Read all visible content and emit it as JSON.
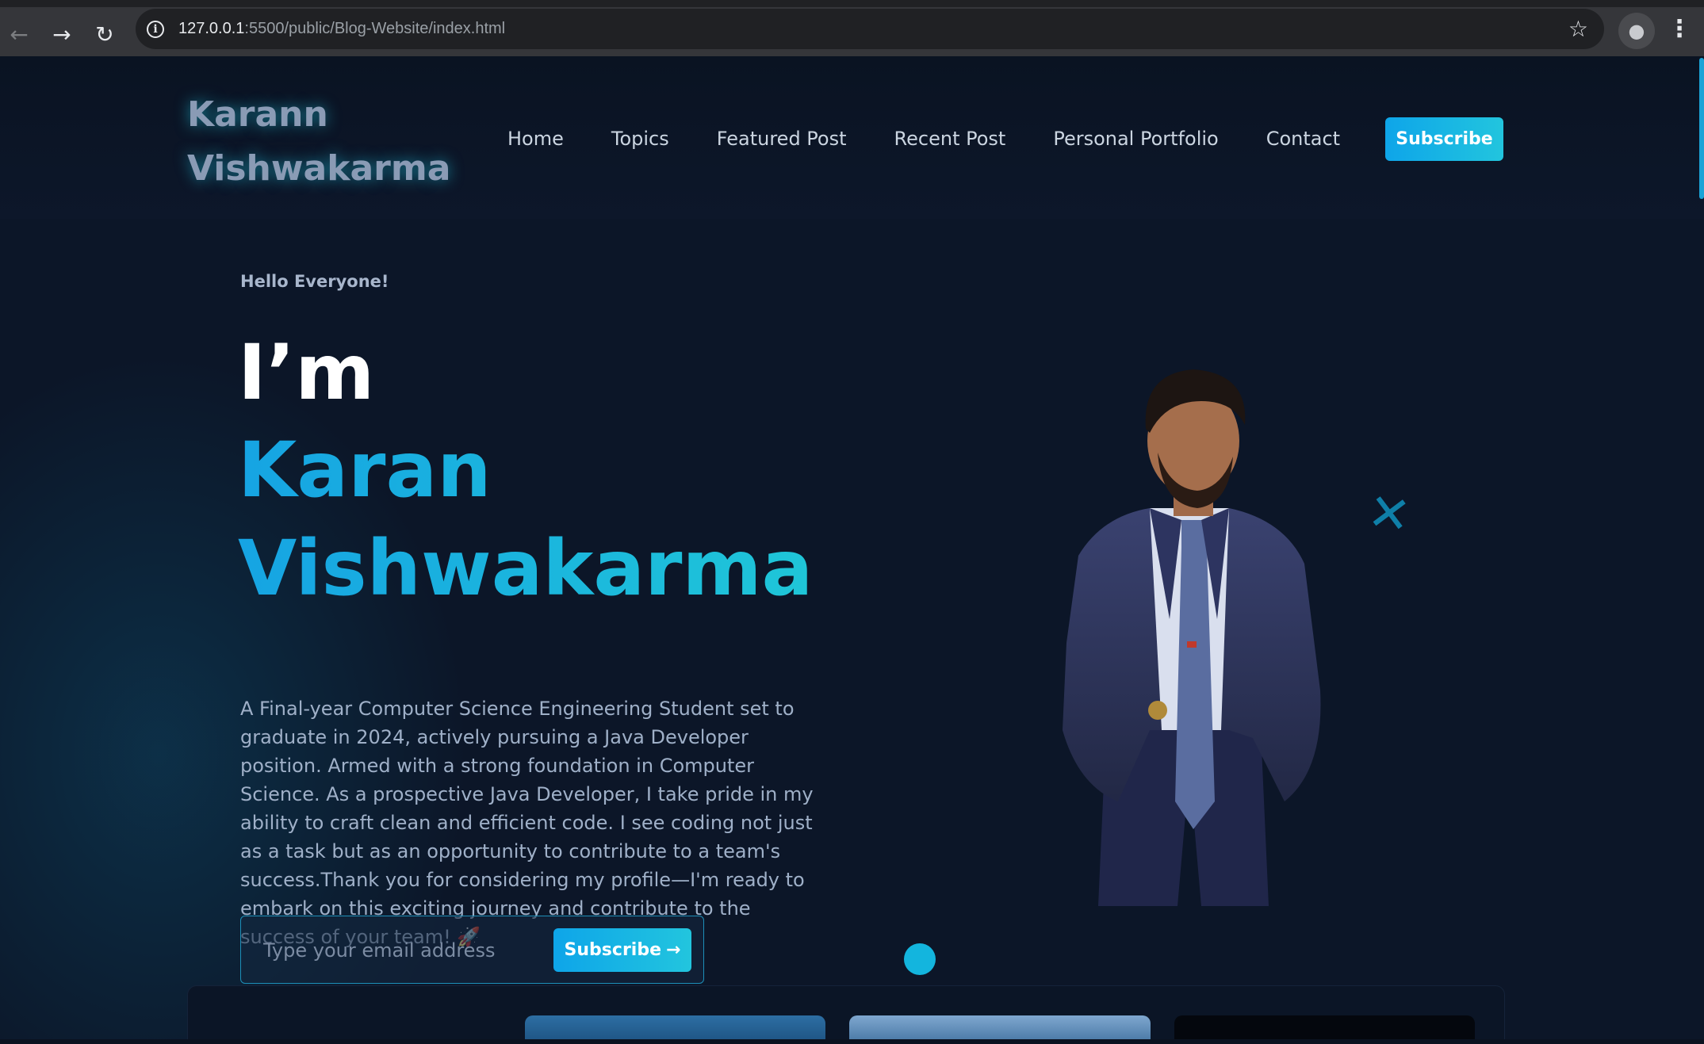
{
  "browser": {
    "url_host": "127.0.0.1",
    "url_rest": ":5500/public/Blog-Website/index.html"
  },
  "header": {
    "logo_line1": "Karann",
    "logo_line2": "Vishwakarma",
    "nav": [
      "Home",
      "Topics",
      "Featured Post",
      "Recent Post",
      "Personal Portfolio",
      "Contact"
    ],
    "subscribe_label": "Subscribe"
  },
  "hero": {
    "greeting": "Hello Everyone!",
    "im": "I’m",
    "name_line1": "Karan",
    "name_line2": "Vishwakarma",
    "bio": "A Final-year Computer Science Engineering Student set to graduate in 2024, actively pursuing a Java Developer position. Armed with a strong foundation in Computer Science. As a prospective Java Developer, I take pride in my ability to craft clean and efficient code. I see coding not just as a task but as an opportunity to contribute to a team's success.Thank you for considering my profile—I'm ready to embark on this exciting journey and contribute to the success of your team! 🚀",
    "email_placeholder": "Type your email address",
    "subscribe_button": "Subscribe"
  },
  "colors": {
    "accent": "#0ea5e9",
    "accent_2": "#22c5de",
    "background": "#0c1628"
  },
  "icons": [
    "back-arrow-icon",
    "forward-arrow-icon",
    "reload-icon",
    "info-icon",
    "bookmark-star-icon",
    "profile-icon",
    "kebab-menu-icon",
    "arrow-right-icon"
  ]
}
